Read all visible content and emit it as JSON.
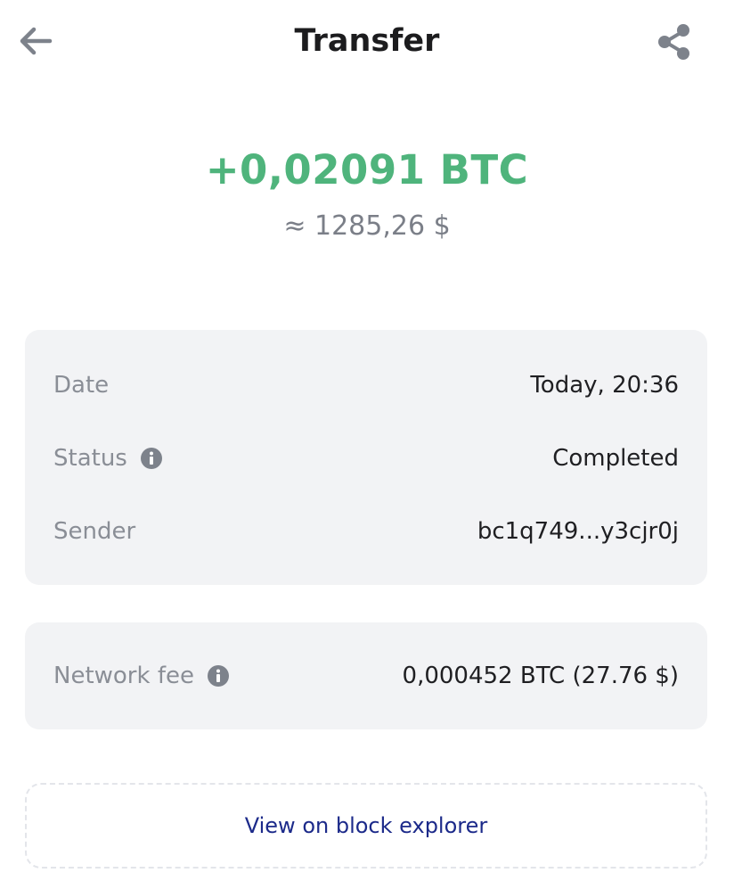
{
  "header": {
    "title": "Transfer",
    "back_icon": "arrow-left-icon",
    "share_icon": "share-icon"
  },
  "summary": {
    "amount": "+0,02091 BTC",
    "fiat_equivalent": "≈ 1285,26 $"
  },
  "details": [
    {
      "label": "Date",
      "value": "Today, 20:36",
      "info": false
    },
    {
      "label": "Status",
      "value": "Completed",
      "info": true
    },
    {
      "label": "Sender",
      "value": "bc1q749...y3cjr0j",
      "info": false
    }
  ],
  "fee": {
    "label": "Network fee",
    "value": "0,000452 BTC (27.76 $)",
    "info": true
  },
  "explorer": {
    "label": "View on block explorer"
  },
  "colors": {
    "amount_green": "#4fb47c",
    "card_bg": "#f2f3f5",
    "link_blue": "#1c2a8a",
    "muted_text": "#8a8e96"
  }
}
